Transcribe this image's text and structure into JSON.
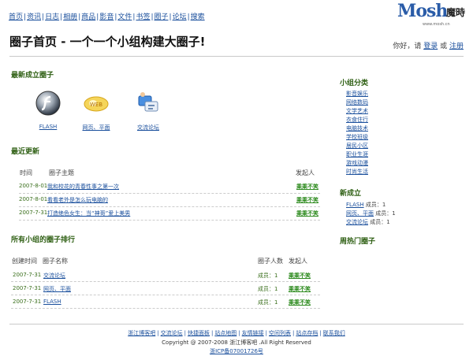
{
  "nav": [
    "首页",
    "资讯",
    "日志",
    "相册",
    "商品",
    "影音",
    "文件",
    "书签",
    "圈子",
    "论坛",
    "搜索"
  ],
  "logo": {
    "mark": "Mosh",
    "cn": "魔時",
    "url": "www.mosh.cn"
  },
  "header": {
    "title": "圈子首页 - 一个一个小组构建大圈子!",
    "greeting": "你好，请",
    "login": "登录",
    "or": "或",
    "register": "注册"
  },
  "newest": {
    "title": "最新成立圈子",
    "groups": [
      {
        "name": "FLASH",
        "icon": "flash-icon"
      },
      {
        "name": "网页、平面",
        "icon": "design-icon"
      },
      {
        "name": "交流论坛",
        "icon": "forum-icon"
      }
    ]
  },
  "recent": {
    "title": "最近更新",
    "headers": {
      "time": "时间",
      "topic": "圈子主题",
      "author": "发起人"
    },
    "rows": [
      {
        "date": "2007-8-01",
        "topic": "我和校花的青春性事之第一次",
        "author": "乘乘不笑"
      },
      {
        "date": "2007-8-01",
        "topic": "看看老外是怎么玩电脑的",
        "author": "乘乘不笑"
      },
      {
        "date": "2007-7-31",
        "topic": "打造绝色女生：当“神哥”爱上美男",
        "author": "乘乘不笑"
      }
    ]
  },
  "ranking": {
    "title": "所有小组的圈子排行",
    "headers": {
      "created": "创建时间",
      "name": "圈子名称",
      "members": "圈子人数",
      "author": "发起人"
    },
    "rows": [
      {
        "date": "2007-7-31",
        "name": "交流论坛",
        "members": "成员：1",
        "author": "乘乘不笑"
      },
      {
        "date": "2007-7-31",
        "name": "网页、平面",
        "members": "成员：1",
        "author": "乘乘不笑"
      },
      {
        "date": "2007-7-31",
        "name": "FLASH",
        "members": "成员：1",
        "author": "乘乘不笑"
      }
    ]
  },
  "sidebar": {
    "cat_title": "小组分类",
    "categories": [
      "影音娱乐",
      "网络数码",
      "文学艺术",
      "衣食住行",
      "电脑技术",
      "学校班级",
      "居民小区",
      "职业生涯",
      "游戏动漫",
      "时尚生活"
    ],
    "new_title": "新成立",
    "new_groups": [
      {
        "name": "FLASH",
        "members": "成员：1"
      },
      {
        "name": "网页、平面",
        "members": "成员：1"
      },
      {
        "name": "交流论坛",
        "members": "成员：1"
      }
    ],
    "hot_title": "周热门圈子"
  },
  "footer": {
    "links": [
      "浙江博客吧",
      "交流论坛",
      "快捷面板",
      "站点地图",
      "友情链接",
      "空间列表",
      "站点存档",
      "联系我们"
    ],
    "copyright": "Copyright @ 2007-2008 浙江博客吧 .All Right Reserved",
    "icp": "浙ICP备07001726号"
  }
}
